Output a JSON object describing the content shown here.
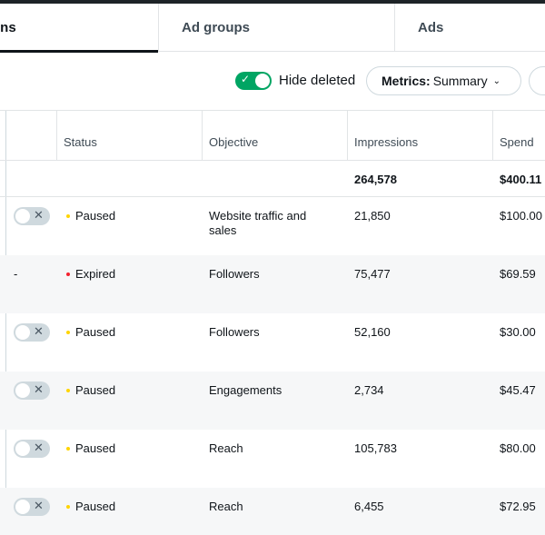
{
  "tabs": [
    {
      "label": "Campaigns",
      "visible_label": "gns"
    },
    {
      "label": "Ad groups"
    },
    {
      "label": "Ads"
    }
  ],
  "controls": {
    "hide_deleted_label": "Hide deleted",
    "hide_deleted_on": true,
    "metrics_label": "Metrics:",
    "metrics_value": "Summary"
  },
  "table": {
    "headers": {
      "status": "Status",
      "objective": "Objective",
      "impressions": "Impressions",
      "spend": "Spend"
    },
    "totals": {
      "impressions": "264,578",
      "spend": "$400.11"
    },
    "rows": [
      {
        "toggle": true,
        "status": "Paused",
        "status_color": "#ffd400",
        "objective": "Website traffic and sales",
        "impressions": "21,850",
        "spend": "$100.00"
      },
      {
        "toggle": false,
        "dash": "-",
        "status": "Expired",
        "status_color": "#f4212e",
        "objective": "Followers",
        "impressions": "75,477",
        "spend": "$69.59"
      },
      {
        "toggle": true,
        "status": "Paused",
        "status_color": "#ffd400",
        "objective": "Followers",
        "impressions": "52,160",
        "spend": "$30.00"
      },
      {
        "toggle": true,
        "status": "Paused",
        "status_color": "#ffd400",
        "objective": "Engagements",
        "impressions": "2,734",
        "spend": "$45.47"
      },
      {
        "toggle": true,
        "status": "Paused",
        "status_color": "#ffd400",
        "objective": "Reach",
        "impressions": "105,783",
        "spend": "$80.00"
      },
      {
        "toggle": true,
        "status": "Paused",
        "status_color": "#ffd400",
        "objective": "Reach",
        "impressions": "6,455",
        "spend": "$72.95"
      }
    ]
  },
  "colors": {
    "accent_green": "#00a563",
    "paused": "#ffd400",
    "expired": "#f4212e"
  },
  "icons": {
    "switch_on": "check-icon",
    "toggle_off": "x-icon",
    "dropdown": "chevron-down-icon"
  }
}
